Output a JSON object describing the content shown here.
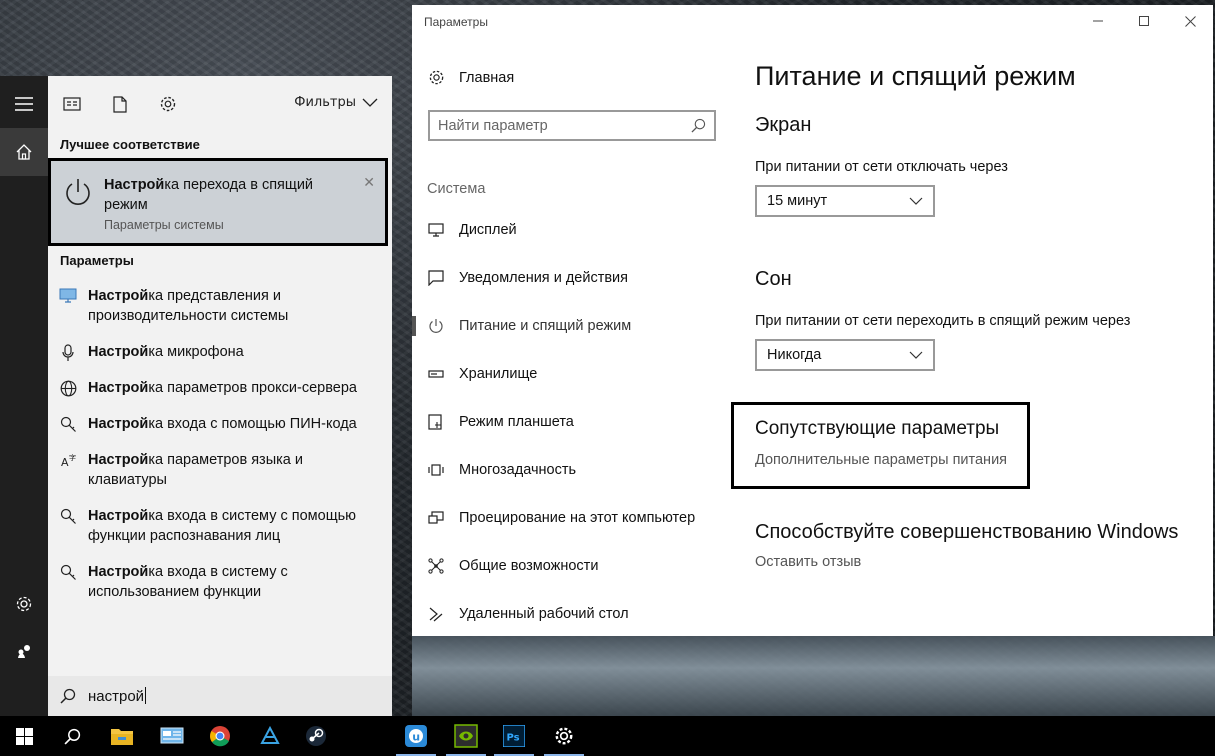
{
  "start_menu": {
    "toolbar": {
      "filters_label": "Фильтры"
    },
    "best_match": {
      "header": "Лучшее соответствие",
      "title_bold": "Настрой",
      "title_rest": "ка перехода в спящий режим",
      "subtitle": "Параметры системы",
      "close": "✕"
    },
    "settings_header": "Параметры",
    "results": [
      {
        "bold": "Настрой",
        "rest": "ка представления и производительности системы",
        "icon": "monitor-icon"
      },
      {
        "bold": "Настрой",
        "rest": "ка микрофона",
        "icon": "microphone-icon"
      },
      {
        "bold": "Настрой",
        "rest": "ка параметров прокси-сервера",
        "icon": "globe-icon"
      },
      {
        "bold": "Настрой",
        "rest": "ка входа с помощью ПИН-кода",
        "icon": "key-icon"
      },
      {
        "bold": "Настрой",
        "rest": "ка параметров языка и клавиатуры",
        "icon": "language-icon"
      },
      {
        "bold": "Настрой",
        "rest": "ка входа в систему с помощью функции распознавания лиц",
        "icon": "key-icon"
      },
      {
        "bold": "Настрой",
        "rest": "ка входа в систему с использованием функции",
        "icon": "key-icon"
      }
    ],
    "search": {
      "value": "настрой"
    }
  },
  "settings": {
    "window_title": "Параметры",
    "home_label": "Главная",
    "find_placeholder": "Найти параметр",
    "nav_group": "Система",
    "nav_items": [
      {
        "label": "Дисплей",
        "icon": "display-icon"
      },
      {
        "label": "Уведомления и действия",
        "icon": "notifications-icon"
      },
      {
        "label": "Питание и спящий режим",
        "icon": "power-icon",
        "selected": true
      },
      {
        "label": "Хранилище",
        "icon": "storage-icon"
      },
      {
        "label": "Режим планшета",
        "icon": "tablet-icon"
      },
      {
        "label": "Многозадачность",
        "icon": "multitasking-icon"
      },
      {
        "label": "Проецирование на этот компьютер",
        "icon": "projecting-icon"
      },
      {
        "label": "Общие возможности",
        "icon": "shared-experiences-icon"
      },
      {
        "label": "Удаленный рабочий стол",
        "icon": "remote-desktop-icon"
      }
    ],
    "content": {
      "page_title": "Питание и спящий режим",
      "screen_title": "Экран",
      "screen_label": "При питании от сети отключать через",
      "screen_value": "15 минут",
      "sleep_title": "Сон",
      "sleep_label": "При питании от сети переходить в спящий режим через",
      "sleep_value": "Никогда",
      "related_title": "Сопутствующие параметры",
      "related_link": "Дополнительные параметры питания",
      "improve_title": "Способствуйте совершенствованию Windows",
      "feedback_link": "Оставить отзыв"
    }
  },
  "colors": {
    "accent_border": "#000000",
    "best_match_bg": "#ccd1d6",
    "taskbar": "#000000"
  }
}
